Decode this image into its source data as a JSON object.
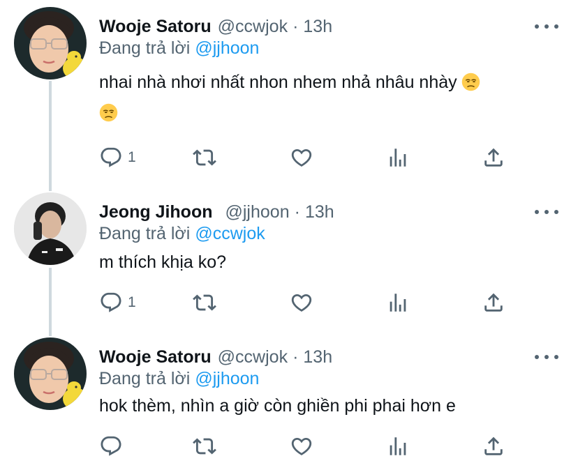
{
  "tweets": [
    {
      "display_name": "Wooje Satoru",
      "handle": "@ccwjok",
      "separator": "·",
      "time": "13h",
      "reply_prefix": "Đang trả lời",
      "reply_to": "@jjhoon",
      "text_line1": "nhai nhà nhơi nhất nhon nhem nhả nhâu nhày",
      "text_line2": "",
      "emoji": "unamused-face-emoji",
      "actions": {
        "reply_count": "1",
        "retweet_count": "",
        "like_count": ""
      }
    },
    {
      "display_name": "Jeong Jihoon",
      "handle": "@jjhoon",
      "separator": "·",
      "time": "13h",
      "reply_prefix": "Đang trả lời",
      "reply_to": "@ccwjok",
      "text_line1": "m thích khịa ko?",
      "actions": {
        "reply_count": "1",
        "retweet_count": "",
        "like_count": ""
      }
    },
    {
      "display_name": "Wooje Satoru",
      "handle": "@ccwjok",
      "separator": "·",
      "time": "13h",
      "reply_prefix": "Đang trả lời",
      "reply_to": "@jjhoon",
      "text_line1": "hok thèm, nhìn a giờ còn ghiền phi phai hơn e",
      "actions": {
        "reply_count": "",
        "retweet_count": "",
        "like_count": ""
      }
    }
  ],
  "icons": {
    "reply": "reply-icon",
    "retweet": "retweet-icon",
    "like": "heart-icon",
    "analytics": "analytics-icon",
    "share": "share-icon",
    "more": "more-icon"
  },
  "colors": {
    "link": "#1d9bf0",
    "secondary_text": "#536471",
    "thread_line": "#cfd9de"
  }
}
